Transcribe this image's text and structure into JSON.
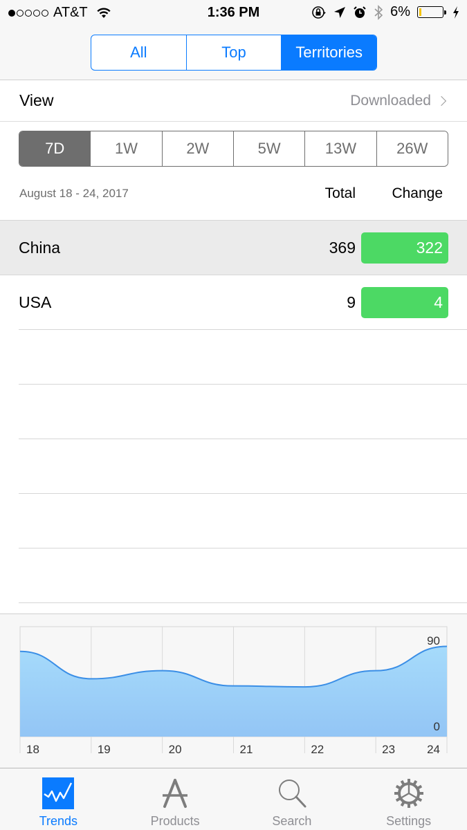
{
  "status_bar": {
    "signal_dots_filled": 1,
    "signal_dots_total": 5,
    "carrier": "AT&T",
    "time": "1:36 PM",
    "battery_percent_label": "6%",
    "battery_level": 0.06,
    "icons": [
      "wifi-icon",
      "rotation-lock-icon",
      "location-arrow-icon",
      "alarm-icon",
      "bluetooth-icon",
      "battery-icon",
      "charging-bolt-icon"
    ]
  },
  "top_segments": {
    "items": [
      {
        "label": "All",
        "active": false
      },
      {
        "label": "Top",
        "active": false
      },
      {
        "label": "Territories",
        "active": true
      }
    ]
  },
  "view": {
    "label": "View",
    "value": "Downloaded"
  },
  "range_segments": {
    "items": [
      {
        "label": "7D",
        "active": true
      },
      {
        "label": "1W",
        "active": false
      },
      {
        "label": "2W",
        "active": false
      },
      {
        "label": "5W",
        "active": false
      },
      {
        "label": "13W",
        "active": false
      },
      {
        "label": "26W",
        "active": false
      }
    ]
  },
  "table": {
    "date_range": "August 18 - 24, 2017",
    "columns": {
      "total": "Total",
      "change": "Change"
    },
    "rows": [
      {
        "name": "China",
        "total": "369",
        "change": "322",
        "selected": true
      },
      {
        "name": "USA",
        "total": "9",
        "change": "4",
        "selected": false
      }
    ],
    "empty_rows": 5
  },
  "colors": {
    "accent": "#0a7bff",
    "positive_change": "#4cd964",
    "range_active": "#6e6e6e",
    "chart_line": "#3a8ee6",
    "chart_fill_top": "#a6dbfb",
    "chart_fill_bottom": "#93c5f5"
  },
  "chart_data": {
    "type": "area",
    "categories": [
      "18",
      "19",
      "20",
      "21",
      "22",
      "23",
      "24"
    ],
    "series": [
      {
        "name": "Downloaded",
        "values": [
          84,
          57,
          65,
          50,
          49,
          65,
          89
        ]
      }
    ],
    "y_tick_labels": [
      "90",
      "0"
    ],
    "ylim": [
      0,
      90
    ],
    "grid": true,
    "title": "",
    "xlabel": "",
    "ylabel": ""
  },
  "tab_bar": {
    "items": [
      {
        "label": "Trends",
        "icon": "trends-icon",
        "active": true
      },
      {
        "label": "Products",
        "icon": "app-store-icon",
        "active": false
      },
      {
        "label": "Search",
        "icon": "search-icon",
        "active": false
      },
      {
        "label": "Settings",
        "icon": "gear-icon",
        "active": false
      }
    ]
  }
}
